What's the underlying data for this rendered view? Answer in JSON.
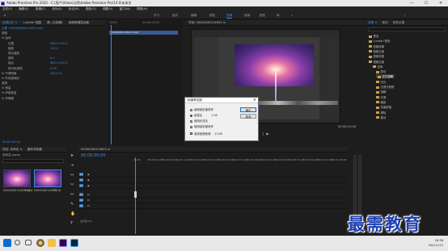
{
  "titlebar": {
    "title": "Adobe Premiere Pro 2020 - C:\\用户\\Video\\示例\\Adobe Premiere Pro\\14.0\\未命名",
    "minimize": "—",
    "maximize": "☐",
    "close": "✕"
  },
  "menu": [
    "文件(F)",
    "编辑(E)",
    "剪辑(C)",
    "序列(S)",
    "标记(M)",
    "图形(G)",
    "视图(V)",
    "窗口(W)",
    "帮助(H)"
  ],
  "workspaces": [
    "学习",
    "组件",
    "编辑",
    "颜色",
    "效果",
    "音频",
    "图形",
    "库"
  ],
  "workspace_active": "效果",
  "effect_controls": {
    "tab": "效果控件 ≡",
    "tab2": "Lumetri 范围",
    "tab3": "源: (无剪辑)",
    "tab4": "音频剪辑混合器",
    "source_label": "主要 * 00000280124623.mp4",
    "clip_label": "00000280124623.mp4",
    "rows": [
      "视频",
      "fx 运动",
      "位置",
      "缩放",
      "等比缩放",
      "旋转",
      "锚点",
      "防闪烁滤镜",
      "fx 不透明度",
      "fx 时间重映射",
      "音频",
      "fx 音量",
      "fx 声道音量",
      "fx 声像器"
    ],
    "values": [
      "",
      "",
      "960.0  540.0",
      "100.0",
      "",
      "0.0",
      "960.0  540.0",
      "0.00",
      "100.0 %",
      "",
      "",
      "",
      "",
      ""
    ],
    "timecode": "00:00:00:00"
  },
  "clip_timeline": {
    "start": "100%",
    "end": "00:00:05:00",
    "clip": "00000280124623.mp4"
  },
  "program": {
    "tab": "节目: 00000280124623 ≡",
    "timecode": "00:00:03:23",
    "fit": "适合",
    "duration": "00:00:15:18"
  },
  "dialog": {
    "title": "帧速率匹配",
    "options": [
      "使用帧定格采样",
      "帧混合",
      "使用光流法",
      "使用帧定格采样"
    ],
    "selected": 1,
    "value": "1.00",
    "checkbox_label": "保持音频音调",
    "checkbox_value": "23.00",
    "ok": "确定",
    "cancel": "取消"
  },
  "effects_panel": {
    "tab": "效果 ≡",
    "tab2": "标记",
    "tab3": "历史记录",
    "items": [
      "预设",
      "Lumetri 预设",
      "音频效果",
      "音频过渡",
      "视频效果",
      "视频过渡",
      "变换",
      "剪切",
      "交叉溶解",
      "闪光",
      "沉浸式视频",
      "溶解",
      "内滑",
      "缩放",
      "页面剥落",
      "擦除",
      "推动"
    ],
    "selected": "交叉溶解"
  },
  "project": {
    "tab": "项目: 未命名 ≡",
    "tab2": "媒体浏览器",
    "name": "未命名.prproj",
    "items": [
      {
        "name": "00000280124623.mp4",
        "dur": "5:00"
      },
      {
        "name": "00000280124623",
        "dur": "15:18"
      }
    ]
  },
  "timeline": {
    "tab": "00000280124623 ≡",
    "timecode": "00:00:00:00",
    "ruler": [
      "00:00",
      "00:00:04:29",
      "00:00:09:29",
      "00:00:14:29",
      "00:00:19:29",
      "00:00:24:29",
      "00:00:29:29",
      "00:00:34:29",
      "00:00:39:29",
      "00:00:44:29",
      "00:00:49:29",
      "00:00:54:29",
      "00:00:59:28",
      "00:01:04:28",
      "00:01:09:28"
    ],
    "video_tracks": [
      "V3",
      "V2",
      "V1"
    ],
    "audio_tracks": [
      "A1",
      "A2",
      "A3"
    ],
    "master": "主声道 0.0"
  },
  "watermark": "最需教育",
  "taskbar": {
    "time": "18:38",
    "date": "2021/1/12"
  }
}
